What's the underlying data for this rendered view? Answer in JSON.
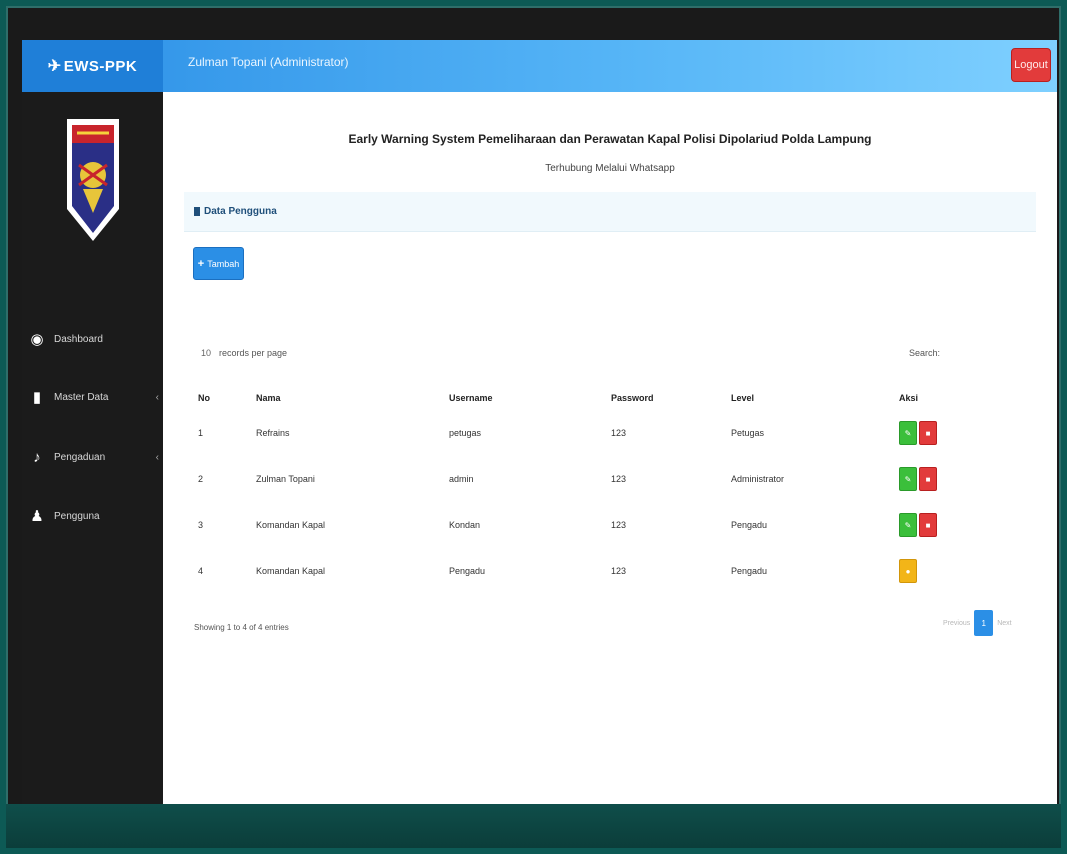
{
  "app": {
    "brand": "EWS-PPK",
    "user_title": "Zulman Topani (Administrator)",
    "logout_label": "Logout"
  },
  "sidebar": {
    "items": [
      {
        "label": "Dashboard",
        "icon": "dashboard-icon"
      },
      {
        "label": "Master Data",
        "icon": "file-icon",
        "expandable": true
      },
      {
        "label": "Pengaduan",
        "icon": "bell-icon",
        "expandable": true
      },
      {
        "label": "Pengguna",
        "icon": "user-icon"
      }
    ]
  },
  "main": {
    "title": "Early Warning System Pemeliharaan dan Perawatan Kapal Polisi Dipolariud Polda Lampung",
    "subtitle": "Terhubung Melalui Whatsapp",
    "panel_title": "Data Pengguna",
    "add_button": "Tambah",
    "rows_per_page_value": "10",
    "rows_per_page_label": "records per page",
    "search_label": "Search:",
    "table": {
      "headers": [
        "No",
        "Nama",
        "Username",
        "Password",
        "Level",
        "Aksi"
      ],
      "rows": [
        {
          "no": "1",
          "nama": "Refrains",
          "username": "petugas",
          "password": "123",
          "level": "Petugas",
          "actions": [
            "edit",
            "delete"
          ]
        },
        {
          "no": "2",
          "nama": "Zulman Topani",
          "username": "admin",
          "password": "123",
          "level": "Administrator",
          "actions": [
            "edit",
            "delete"
          ]
        },
        {
          "no": "3",
          "nama": "Komandan Kapal",
          "username": "Kondan",
          "password": "123",
          "level": "Pengadu",
          "actions": [
            "edit",
            "delete"
          ]
        },
        {
          "no": "4",
          "nama": "Komandan Kapal",
          "username": "Pengadu",
          "password": "123",
          "level": "Pengadu",
          "actions": [
            "detail"
          ]
        }
      ]
    },
    "showing": "Showing 1 to 4 of 4 entries",
    "pagination": {
      "previous": "Previous",
      "current": "1",
      "next": "Next"
    }
  },
  "colors": {
    "navbar": "#2b8fe6",
    "sidebar": "#1b1b1b",
    "edit": "#3bbf3b",
    "delete": "#e23b3b",
    "detail": "#f2b518",
    "frame": "#0d5a55"
  }
}
